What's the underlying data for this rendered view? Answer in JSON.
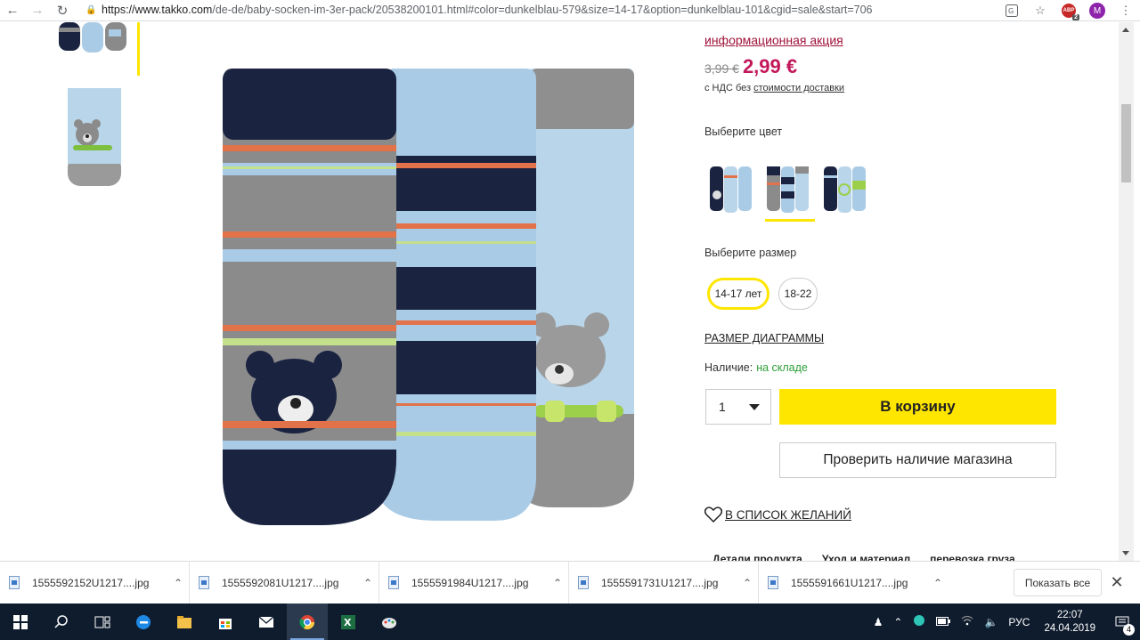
{
  "browser": {
    "url_host": "https://www.takko.com",
    "url_path": "/de-de/baby-socken-im-3er-pack/20538200101.html#color=dunkelblau-579&size=14-17&option=dunkelblau-101&cgid=sale&start=706",
    "profile_initial": "M",
    "ext_badge_count": "2",
    "ext_label": "ABP"
  },
  "product": {
    "promo_link": "информационная акция",
    "old_price": "3,99 €",
    "new_price": "2,99 €",
    "vat_prefix": "с НДС без",
    "vat_link": "стоимости доставки",
    "color_label": "Выберите цвет",
    "size_label": "Выберите размер",
    "sizes": [
      "14-17 лет",
      "18-22"
    ],
    "size_chart_link": "РАЗМЕР ДИАГРАММЫ",
    "availability_label": "Наличие:",
    "availability_value": "на складе",
    "quantity": "1",
    "add_to_cart": "В корзину",
    "check_store": "Проверить наличие магазина",
    "wishlist": "В СПИСОК ЖЕЛАНИЙ",
    "tabs": [
      "Детали продукта",
      "Уход и материал",
      "перевозка груза"
    ]
  },
  "downloads": {
    "files": [
      "1555592152U1217....jpg",
      "1555592081U1217....jpg",
      "1555591984U1217....jpg",
      "1555591731U1217....jpg",
      "1555591661U1217....jpg"
    ],
    "show_all": "Показать все"
  },
  "taskbar": {
    "lang": "РУС",
    "time": "22:07",
    "date": "24.04.2019",
    "notifications": "4"
  }
}
